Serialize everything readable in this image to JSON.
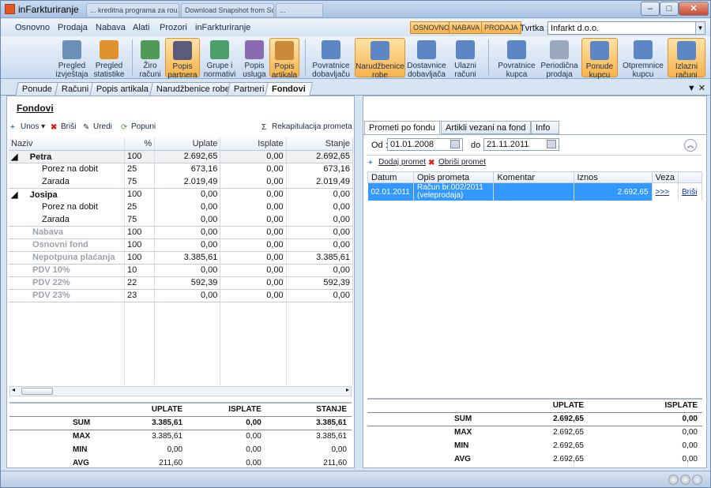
{
  "window": {
    "title": "inFarkturiranje",
    "bgtabs": [
      "... kreditna programa za rou...",
      "Download Snapshot from Source...",
      "..."
    ]
  },
  "menu": {
    "items": [
      "Osnovno",
      "Prodaja",
      "Nabava",
      "Alati",
      "Prozori",
      "inFarkturiranje"
    ],
    "modes": [
      "OSNOVNO",
      "NABAVA",
      "PRODAJA"
    ],
    "tvrtka_label": "Tvrtka :",
    "tvrtka_value": "Infarkt d.o.o."
  },
  "ribbon": [
    {
      "l1": "Pregled",
      "l2": "izvještaja"
    },
    {
      "l1": "Pregled",
      "l2": "statistike"
    },
    {
      "l1": "Žiro",
      "l2": "računi"
    },
    {
      "l1": "Popis",
      "l2": "partnera"
    },
    {
      "l1": "Grupe i",
      "l2": "normativi"
    },
    {
      "l1": "Popis",
      "l2": "usluga"
    },
    {
      "l1": "Popis",
      "l2": "artikala"
    },
    {
      "l1": "Povratnice",
      "l2": "dobavljaču"
    },
    {
      "l1": "Narudžbenice",
      "l2": "robe"
    },
    {
      "l1": "Dostavnice",
      "l2": "dobavljača"
    },
    {
      "l1": "Ulazni",
      "l2": "računi"
    },
    {
      "l1": "Povratnice",
      "l2": "kupca"
    },
    {
      "l1": "Periodična",
      "l2": "prodaja"
    },
    {
      "l1": "Ponude",
      "l2": "kupcu"
    },
    {
      "l1": "Otpremnice",
      "l2": "kupcu"
    },
    {
      "l1": "Izlazni",
      "l2": "računi"
    }
  ],
  "doctabs": [
    "Ponude",
    "Računi",
    "Popis artikala",
    "Narudžbenice robe",
    "Partneri",
    "Fondovi"
  ],
  "left": {
    "title": "Fondovi",
    "toolbar": {
      "unos": "Unos",
      "brisi": "Briši",
      "uredi": "Uredi",
      "popuni": "Popuni",
      "rekap": "Rekapitulacija prometa"
    },
    "headers": [
      "Naziv",
      "%",
      "Uplate",
      "Isplate",
      "Stanje"
    ],
    "rows": [
      [
        "Petra",
        "100",
        "2.692,65",
        "0,00",
        "2.692,65"
      ],
      [
        "Porez na dobit",
        "25",
        "673,16",
        "0,00",
        "673,16"
      ],
      [
        "Zarada",
        "75",
        "2.019,49",
        "0,00",
        "2.019,49"
      ],
      [
        "Josipa",
        "100",
        "0,00",
        "0,00",
        "0,00"
      ],
      [
        "Porez na dobit",
        "25",
        "0,00",
        "0,00",
        "0,00"
      ],
      [
        "Zarada",
        "75",
        "0,00",
        "0,00",
        "0,00"
      ],
      [
        "Nabava",
        "100",
        "0,00",
        "0,00",
        "0,00"
      ],
      [
        "Osnovni fond",
        "100",
        "0,00",
        "0,00",
        "0,00"
      ],
      [
        "Nepotpuna plaćanja",
        "100",
        "3.385,61",
        "0,00",
        "3.385,61"
      ],
      [
        "PDV 10%",
        "10",
        "0,00",
        "0,00",
        "0,00"
      ],
      [
        "PDV 22%",
        "22",
        "592,39",
        "0,00",
        "592,39"
      ],
      [
        "PDV 23%",
        "23",
        "0,00",
        "0,00",
        "0,00"
      ]
    ],
    "sum": {
      "headers": [
        "UPLATE",
        "ISPLATE",
        "STANJE"
      ],
      "rows": [
        [
          "SUM",
          "3.385,61",
          "0,00",
          "3.385,61"
        ],
        [
          "MAX",
          "3.385,61",
          "0,00",
          "3.385,61"
        ],
        [
          "MIN",
          "0,00",
          "0,00",
          "0,00"
        ],
        [
          "AVG",
          "211,60",
          "0,00",
          "211,60"
        ]
      ]
    }
  },
  "right": {
    "tabs": [
      "Prometi po fondu",
      "Artikli vezani na fond",
      "Info"
    ],
    "od_label": "Od :",
    "od_value": "01.01.2008",
    "do_label": "do",
    "do_value": "21.11.2011",
    "dodaj": "Dodaj promet",
    "obrisi": "Obriši promet",
    "headers": [
      "Datum",
      "Opis prometa",
      "Komentar",
      "Iznos",
      "Veza"
    ],
    "row": {
      "datum": "02.01.2011",
      "opis1": "Račun br.002/2011",
      "opis2": "(veleprodaja)",
      "komentar": "",
      "iznos": "2.692,65",
      "veza": ">>>",
      "brisi": "Briši"
    },
    "sum": {
      "headers": [
        "UPLATE",
        "ISPLATE"
      ],
      "rows": [
        [
          "SUM",
          "2.692,65",
          "0,00"
        ],
        [
          "MAX",
          "2.692,65",
          "0,00"
        ],
        [
          "MIN",
          "2.692,65",
          "0,00"
        ],
        [
          "AVG",
          "2.692,65",
          "0,00"
        ]
      ]
    }
  }
}
